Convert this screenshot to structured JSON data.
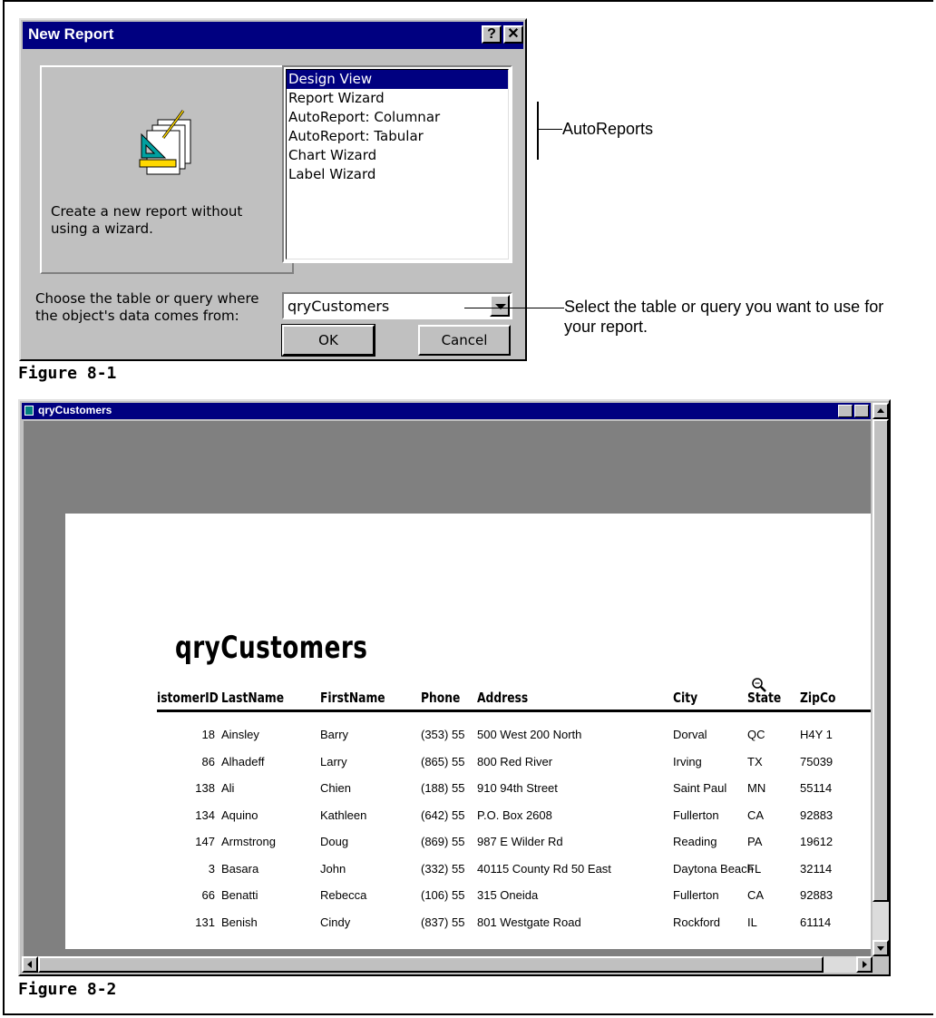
{
  "dialog": {
    "title": "New Report",
    "help_label": "?",
    "close_label": "✕",
    "description": "Create a new report without using a wizard.",
    "options": [
      "Design View",
      "Report Wizard",
      "AutoReport:  Columnar",
      "AutoReport:  Tabular",
      "Chart Wizard",
      "Label Wizard"
    ],
    "selected_option": "Design View",
    "source_label": "Choose the table or query where the object's data comes from:",
    "source_value": "qryCustomers",
    "ok_label": "OK",
    "cancel_label": "Cancel"
  },
  "callouts": {
    "autoreports": "AutoReports",
    "select_source": "Select the table or query you want to use for your report."
  },
  "figures": {
    "fig1": "Figure 8-1",
    "fig2": "Figure 8-2"
  },
  "report_window": {
    "title": "qryCustomers",
    "report_title": "qryCustomers",
    "columns": [
      "istomerID",
      "LastName",
      "FirstName",
      "Phone",
      "Address",
      "City",
      "State",
      "ZipCo"
    ],
    "rows": [
      [
        "18",
        "Ainsley",
        "Barry",
        "(353) 55",
        "500 West 200 North",
        "Dorval",
        "QC",
        "H4Y 1"
      ],
      [
        "86",
        "Alhadeff",
        "Larry",
        "(865) 55",
        "800 Red River",
        "Irving",
        "TX",
        "75039"
      ],
      [
        "138",
        "Ali",
        "Chien",
        "(188) 55",
        "910 94th Street",
        "Saint Paul",
        "MN",
        "55114"
      ],
      [
        "134",
        "Aquino",
        "Kathleen",
        "(642) 55",
        "P.O. Box 2608",
        "Fullerton",
        "CA",
        "92883"
      ],
      [
        "147",
        "Armstrong",
        "Doug",
        "(869) 55",
        "987 E Wilder Rd",
        "Reading",
        "PA",
        "19612"
      ],
      [
        "3",
        "Basara",
        "John",
        "(332) 55",
        "40115 County Rd 50 East",
        "Daytona Beach",
        "FL",
        "32114"
      ],
      [
        "66",
        "Benatti",
        "Rebecca",
        "(106) 55",
        "315 Oneida",
        "Fullerton",
        "CA",
        "92883"
      ],
      [
        "131",
        "Benish",
        "Cindy",
        "(837) 55",
        "801 Westgate Road",
        "Rockford",
        "IL",
        "61114"
      ]
    ]
  }
}
